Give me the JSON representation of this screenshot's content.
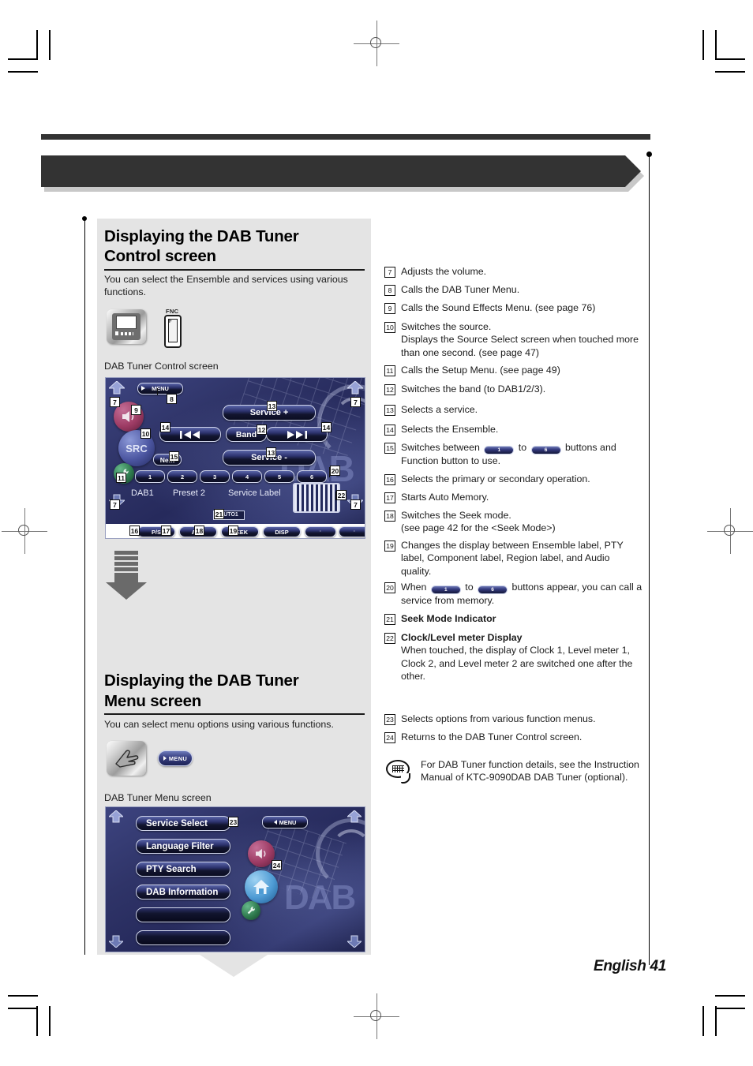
{
  "page": {
    "footer": "English 41",
    "language": "English",
    "number": "41"
  },
  "sections": [
    {
      "heading_line1": "Displaying the DAB Tuner",
      "heading_line2": "Control screen",
      "lead": "You can select the Ensemble and services using various functions.",
      "icons": [
        "monitor-panel-icon",
        "fnc-button-icon"
      ],
      "fnc_label": "FNC",
      "fnc_key": "F",
      "screen_caption": "DAB Tuner Control screen"
    },
    {
      "heading_line1": "Displaying the DAB Tuner",
      "heading_line2": "Menu screen",
      "lead": "You can select menu options using various functions.",
      "icons": [
        "hand-touch-icon",
        "menu-pill-button"
      ],
      "menu_pill_label": "MENU",
      "screen_caption": "DAB Tuner Menu screen"
    }
  ],
  "control_screen": {
    "watermark": "DAB",
    "menu_button": "MENU",
    "src_button": "SRC",
    "next_button": "Next",
    "band_button": "Band",
    "service_plus": "Service +",
    "service_minus": "Service -",
    "prev_ensemble": "│◀◀",
    "next_ensemble": "▶▶│",
    "presets": [
      "1",
      "2",
      "3",
      "4",
      "5",
      "6"
    ],
    "status": {
      "band": "DAB1",
      "preset": "Preset 2",
      "label": "Service Label"
    },
    "seek_indicator": "AUTO1",
    "function_buttons": [
      "P/S",
      "AME",
      "SEEK",
      "DISP",
      "·",
      "·"
    ],
    "callouts": [
      "7",
      "8",
      "9",
      "10",
      "11",
      "12",
      "13",
      "14",
      "15",
      "16",
      "17",
      "18",
      "19",
      "20",
      "21",
      "22"
    ]
  },
  "menu_screen": {
    "watermark": "DAB",
    "menu_button": "MENU",
    "options": [
      "Service Select",
      "Language Filter",
      "PTY Search",
      "DAB Information"
    ],
    "blank_options": [
      "",
      ""
    ],
    "callouts": [
      "23",
      "24"
    ]
  },
  "descriptions": [
    {
      "num": "7",
      "text": "Adjusts the volume.",
      "bold": false
    },
    {
      "num": "8",
      "text": "Calls the DAB Tuner Menu.",
      "bold": false
    },
    {
      "num": "9",
      "text": "Calls the Sound Effects Menu. (see page 76)",
      "bold": false
    },
    {
      "num": "10",
      "text": "Switches the source.\nDisplays the Source Select screen when touched more than one second. (see page 47)",
      "bold": false
    },
    {
      "num": "11",
      "text": "Calls the Setup Menu. (see page 49)",
      "bold": false
    },
    {
      "num": "12",
      "text": "Switches the band (to DAB1/2/3).",
      "bold": false
    },
    {
      "num": "13",
      "text": "Selects a service.",
      "bold": false
    },
    {
      "num": "14",
      "text": "Selects the Ensemble.",
      "bold": false
    },
    {
      "num": "15",
      "text": "Switches between [1] to [6] buttons and Function button to use.",
      "bold": false,
      "rich": [
        "Switches between ",
        "PILL1",
        " to ",
        "PILL6",
        " buttons and Function button to use."
      ]
    },
    {
      "num": "16",
      "text": "Selects the primary or secondary operation.",
      "bold": false
    },
    {
      "num": "17",
      "text": "Starts Auto Memory.",
      "bold": false
    },
    {
      "num": "18",
      "text": "Switches the Seek mode.\n(see page 42 for the <Seek Mode>)",
      "bold": false
    },
    {
      "num": "19",
      "text": "Changes the display between Ensemble label, PTY label, Component label, Region label, and Audio quality.",
      "bold": false
    },
    {
      "num": "20",
      "text": "When [1] to [6] buttons appear, you can call a service from memory.",
      "bold": false,
      "rich": [
        "When ",
        "PILL1",
        " to ",
        "PILL6",
        " buttons appear, you can call a service from memory."
      ]
    },
    {
      "num": "21",
      "text": "Seek Mode Indicator",
      "bold": true
    },
    {
      "num": "22",
      "text": "Clock/Level meter Display",
      "bold": true,
      "sub": "When touched, the display of Clock 1, Level meter 1, Clock 2, and Level meter 2 are switched one after the other."
    },
    {
      "num": "23",
      "text": "Selects options from various function menus.",
      "bold": false
    },
    {
      "num": "24",
      "text": "Returns to the DAB Tuner Control screen.",
      "bold": false
    }
  ],
  "note": {
    "icon": "speech-bubble-icon",
    "text": "For DAB Tuner function details, see the Instruction Manual of KTC-9090DAB DAB Tuner (optional)."
  },
  "colors": {
    "panel_gray": "#e4e4e4",
    "banner_dark": "#333333",
    "screen_blue": "#2f3468",
    "accent_magenta": "#9d3b64",
    "accent_green": "#2f7a4e",
    "text": "#1c1c1c"
  }
}
